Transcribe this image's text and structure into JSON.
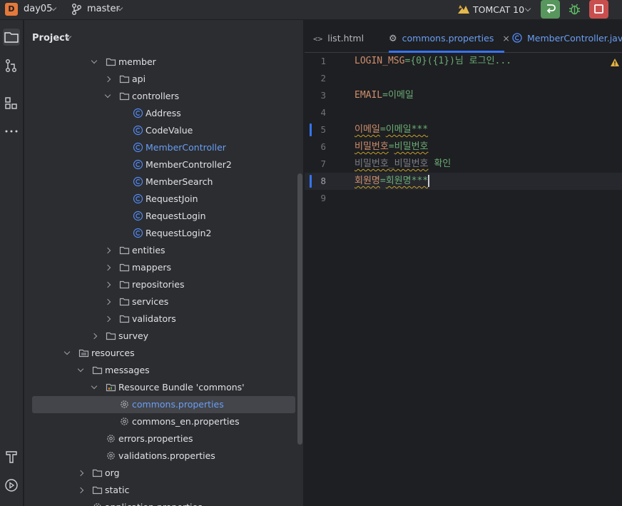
{
  "titlebar": {
    "project_badge": "D",
    "project_name": "day05",
    "branch": "master",
    "run_config": "TOMCAT 10"
  },
  "colors": {
    "accent": "#3574f0",
    "run_green": "#57965c",
    "stop_red": "#c94f4f",
    "property_key": "#cf8e6d",
    "property_value": "#6aab73"
  },
  "toolstrip": {
    "icons": [
      "folder-icon",
      "commit-icon",
      "structure-icon",
      "more-icon",
      "build-icon",
      "services-icon"
    ]
  },
  "project_panel": {
    "title": "Project",
    "tree": [
      {
        "label": "member",
        "kind": "folder",
        "indent": 1,
        "expanded": true
      },
      {
        "label": "api",
        "kind": "folder",
        "indent": 2,
        "expanded": false
      },
      {
        "label": "controllers",
        "kind": "folder",
        "indent": 2,
        "expanded": true
      },
      {
        "label": "Address",
        "kind": "class",
        "indent": 3
      },
      {
        "label": "CodeValue",
        "kind": "class",
        "indent": 3
      },
      {
        "label": "MemberController",
        "kind": "class",
        "indent": 3,
        "highlight": true
      },
      {
        "label": "MemberController2",
        "kind": "class",
        "indent": 3
      },
      {
        "label": "MemberSearch",
        "kind": "class",
        "indent": 3
      },
      {
        "label": "RequestJoin",
        "kind": "class",
        "indent": 3
      },
      {
        "label": "RequestLogin",
        "kind": "class",
        "indent": 3
      },
      {
        "label": "RequestLogin2",
        "kind": "record",
        "indent": 3
      },
      {
        "label": "entities",
        "kind": "folder",
        "indent": 2,
        "expanded": false
      },
      {
        "label": "mappers",
        "kind": "folder",
        "indent": 2,
        "expanded": false
      },
      {
        "label": "repositories",
        "kind": "folder",
        "indent": 2,
        "expanded": false
      },
      {
        "label": "services",
        "kind": "folder",
        "indent": 2,
        "expanded": false
      },
      {
        "label": "validators",
        "kind": "folder",
        "indent": 2,
        "expanded": false
      },
      {
        "label": "survey",
        "kind": "folder",
        "indent": 1,
        "expanded": false
      },
      {
        "label": "resources",
        "kind": "resfolder",
        "indent": -1,
        "expanded": true
      },
      {
        "label": "messages",
        "kind": "folder",
        "indent": 0,
        "expanded": true
      },
      {
        "label": "Resource Bundle 'commons'",
        "kind": "bundle",
        "indent": 1,
        "expanded": true
      },
      {
        "label": "commons.properties",
        "kind": "props",
        "indent": 2,
        "selected": true,
        "highlight": true
      },
      {
        "label": "commons_en.properties",
        "kind": "props",
        "indent": 2
      },
      {
        "label": "errors.properties",
        "kind": "props",
        "indent": 1
      },
      {
        "label": "validations.properties",
        "kind": "props",
        "indent": 1
      },
      {
        "label": "org",
        "kind": "folder",
        "indent": 0,
        "expanded": false
      },
      {
        "label": "static",
        "kind": "folder",
        "indent": 0,
        "expanded": false
      },
      {
        "label": "application.properties",
        "kind": "props",
        "indent": 0
      }
    ]
  },
  "editor": {
    "tabs": [
      {
        "label": "list.html",
        "icon": "html-icon",
        "active": false
      },
      {
        "label": "commons.properties",
        "icon": "gear-icon",
        "active": true
      },
      {
        "label": "MemberController.java",
        "icon": "class-icon",
        "active": false
      }
    ],
    "lines": [
      {
        "n": "1",
        "key": "LOGIN_MSG",
        "sep": "=",
        "value": "{0}({1})님 로그인...",
        "squig": false,
        "changed": false
      },
      {
        "n": "2",
        "key": "",
        "sep": "",
        "value": "",
        "squig": false,
        "changed": false
      },
      {
        "n": "3",
        "key": "EMAIL",
        "sep": "=",
        "value": "이메일",
        "squig": false,
        "changed": false
      },
      {
        "n": "4",
        "key": "",
        "sep": "",
        "value": "",
        "squig": false,
        "changed": false
      },
      {
        "n": "5",
        "key": "이메일",
        "sep": "=",
        "value": "이메일***",
        "squig": true,
        "changed": true
      },
      {
        "n": "6",
        "key": "비밀번호",
        "sep": "=",
        "value": "비밀번호",
        "squig": true,
        "changed": false
      },
      {
        "n": "7",
        "key": "비밀번호_비밀번호",
        "sep": " ",
        "value": "확인",
        "squig": true,
        "changed": false,
        "dim": true
      },
      {
        "n": "8",
        "key": "회원명",
        "sep": "=",
        "value": "회원명***",
        "squig": true,
        "changed": true,
        "current": true
      },
      {
        "n": "9",
        "key": "",
        "sep": "",
        "value": "",
        "squig": false,
        "changed": false
      }
    ]
  }
}
